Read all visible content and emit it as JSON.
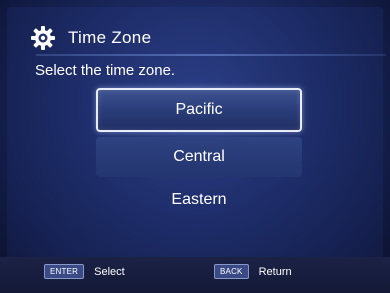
{
  "header": {
    "title": "Time  Zone",
    "icon": "gear-icon"
  },
  "prompt": "Select the time zone.",
  "options": [
    {
      "label": "Pacific",
      "selected": true
    },
    {
      "label": "Central",
      "selected": false
    },
    {
      "label": "Eastern",
      "selected": false
    }
  ],
  "footer": {
    "enter_key": "ENTER",
    "enter_label": "Select",
    "back_key": "BACK",
    "back_label": "Return"
  },
  "colors": {
    "background": "#1e2d6a",
    "highlight_border": "#e9edf8",
    "text": "#ffffff"
  }
}
